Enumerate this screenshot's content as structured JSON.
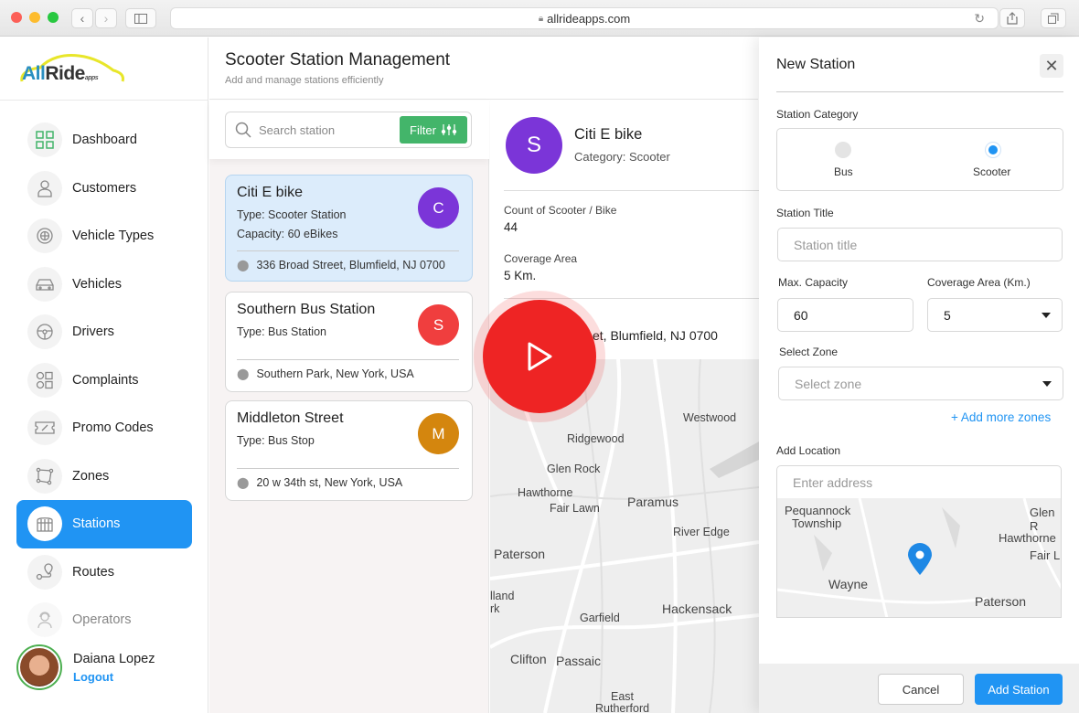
{
  "browser": {
    "url": "allrideapps.com",
    "icons": [
      "back-icon",
      "forward-icon",
      "sidebar-toggle-icon",
      "lock-icon",
      "reload-icon",
      "share-icon",
      "tabs-icon"
    ]
  },
  "brand": {
    "part1": "All",
    "part2": "Ride",
    "suffix": "apps",
    "accent": "#2094f3"
  },
  "sidebar": {
    "items": [
      {
        "label": "Dashboard",
        "icon": "dashboard-grid-icon",
        "active": false
      },
      {
        "label": "Customers",
        "icon": "user-icon",
        "active": false
      },
      {
        "label": "Vehicle Types",
        "icon": "wheel-icon",
        "active": false
      },
      {
        "label": "Vehicles",
        "icon": "car-icon",
        "active": false
      },
      {
        "label": "Drivers",
        "icon": "steering-wheel-icon",
        "active": false
      },
      {
        "label": "Complaints",
        "icon": "complaints-icon",
        "active": false
      },
      {
        "label": "Promo Codes",
        "icon": "ticket-percent-icon",
        "active": false
      },
      {
        "label": "Zones",
        "icon": "zone-polygon-icon",
        "active": false
      },
      {
        "label": "Stations",
        "icon": "station-icon",
        "active": true
      },
      {
        "label": "Routes",
        "icon": "route-icon",
        "active": false
      },
      {
        "label": "Operators",
        "icon": "operator-icon",
        "active": false
      }
    ],
    "user": {
      "name": "Daiana Lopez",
      "logout": "Logout"
    }
  },
  "header": {
    "title": "Scooter Station Management",
    "subtitle": "Add and manage stations efficiently"
  },
  "list": {
    "search_placeholder": "Search station",
    "filter_label": "Filter",
    "stations": [
      {
        "title": "Citi E bike",
        "type": "Type: Scooter Station",
        "capacity": "Capacity: 60 eBikes",
        "address": "336 Broad Street, Blumfield, NJ 0700",
        "initial": "C",
        "color": "#7b35d8",
        "selected": true
      },
      {
        "title": "Southern Bus Station",
        "type": "Type: Bus Station",
        "address": "Southern Park, New York, USA",
        "initial": "S",
        "color": "#f03e3e",
        "selected": false
      },
      {
        "title": "Middleton Street",
        "type": "Type: Bus Stop",
        "address": "20 w 34th st, New York, USA",
        "initial": "M",
        "color": "#d4860e",
        "selected": false
      }
    ]
  },
  "detail": {
    "initial": "S",
    "title": "Citi E bike",
    "category": "Category: Scooter",
    "count_label": "Count of Scooter / Bike",
    "count_value": "44",
    "coverage_label": "Coverage Area",
    "coverage_value": "5 Km.",
    "address_visible": "et, Blumfield, NJ 0700",
    "map_labels": [
      "Westwood",
      "Ridgewood",
      "Glen Rock",
      "Hawthorne",
      "Fair Lawn",
      "Paramus",
      "River Edge",
      "Paterson",
      "lland",
      "rk",
      "Hackensack",
      "Garfield",
      "Clifton",
      "Passaic",
      "East",
      "Rutherford"
    ]
  },
  "video": {
    "play_icon": "play-icon",
    "color": "#ee2424"
  },
  "panel": {
    "title": "New Station",
    "category_label": "Station Category",
    "categories": [
      {
        "label": "Bus",
        "selected": false
      },
      {
        "label": "Scooter",
        "selected": true
      }
    ],
    "title_label": "Station Title",
    "title_placeholder": "Station title",
    "capacity_label": "Max. Capacity",
    "capacity_value": "60",
    "coverage_label": "Coverage Area (Km.)",
    "coverage_value": "5",
    "zone_label": "Select Zone",
    "zone_placeholder": "Select zone",
    "add_zones": "+ Add more zones",
    "location_label": "Add Location",
    "address_placeholder": "Enter address",
    "map_labels": [
      "Pequannock",
      "Township",
      "Glen R",
      "Hawthorne",
      "Fair L",
      "Wayne",
      "Paterson"
    ],
    "cancel": "Cancel",
    "submit": "Add Station"
  }
}
